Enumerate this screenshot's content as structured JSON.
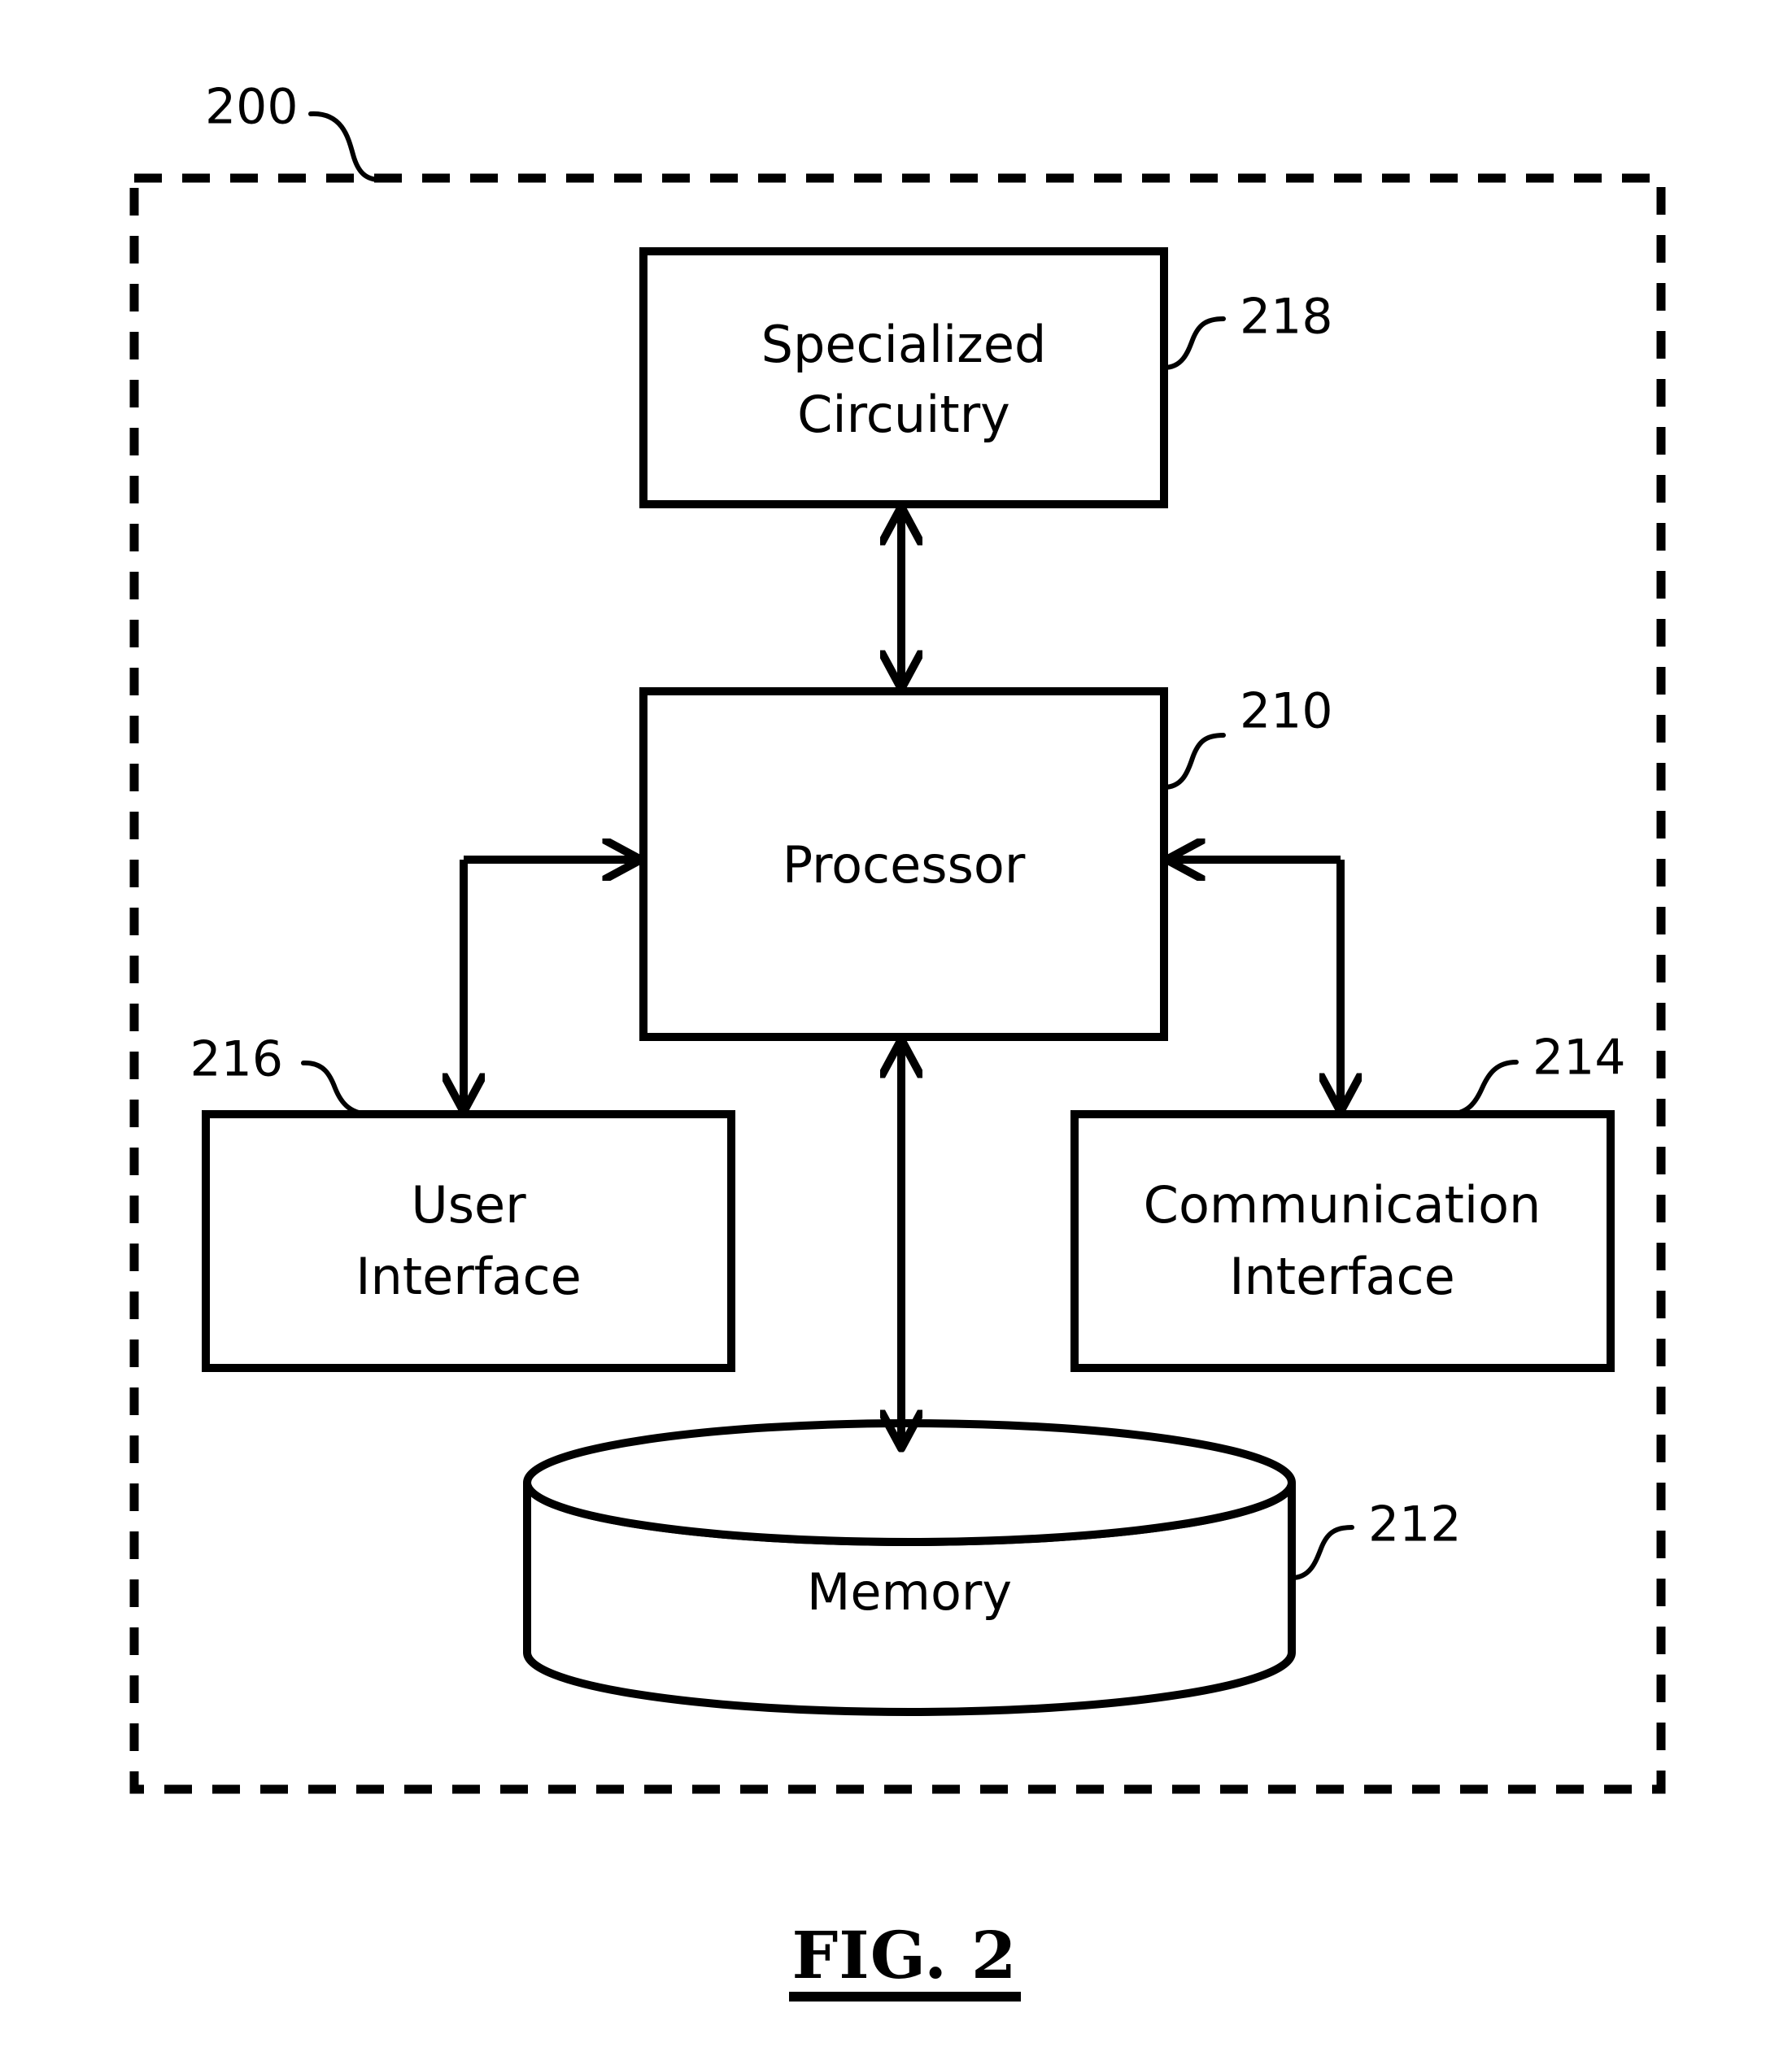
{
  "figure": {
    "caption": "FIG. 2",
    "system_ref": "200"
  },
  "blocks": [
    {
      "id": "specialized-circuitry",
      "label_line1": "Specialized",
      "label_line2": "Circuitry",
      "ref": "218",
      "shape": "rectangle"
    },
    {
      "id": "processor",
      "label_line1": "Processor",
      "label_line2": "",
      "ref": "210",
      "shape": "rectangle"
    },
    {
      "id": "user-interface",
      "label_line1": "User",
      "label_line2": "Interface",
      "ref": "216",
      "shape": "rectangle"
    },
    {
      "id": "communication-interface",
      "label_line1": "Communication",
      "label_line2": "Interface",
      "ref": "214",
      "shape": "rectangle"
    },
    {
      "id": "memory",
      "label_line1": "Memory",
      "label_line2": "",
      "ref": "212",
      "shape": "cylinder"
    }
  ],
  "connections": [
    {
      "from": "processor",
      "to": "specialized-circuitry",
      "style": "double-arrow"
    },
    {
      "from": "processor",
      "to": "memory",
      "style": "double-arrow"
    },
    {
      "from": "user-interface",
      "to": "processor",
      "style": "single-arrow-elbow"
    },
    {
      "from": "processor",
      "to": "user-interface",
      "style": "single-arrow-elbow"
    },
    {
      "from": "communication-interface",
      "to": "processor",
      "style": "single-arrow-elbow"
    },
    {
      "from": "processor",
      "to": "communication-interface",
      "style": "single-arrow-elbow"
    }
  ],
  "colors": {
    "ink": "#000000",
    "paper": "#ffffff"
  }
}
